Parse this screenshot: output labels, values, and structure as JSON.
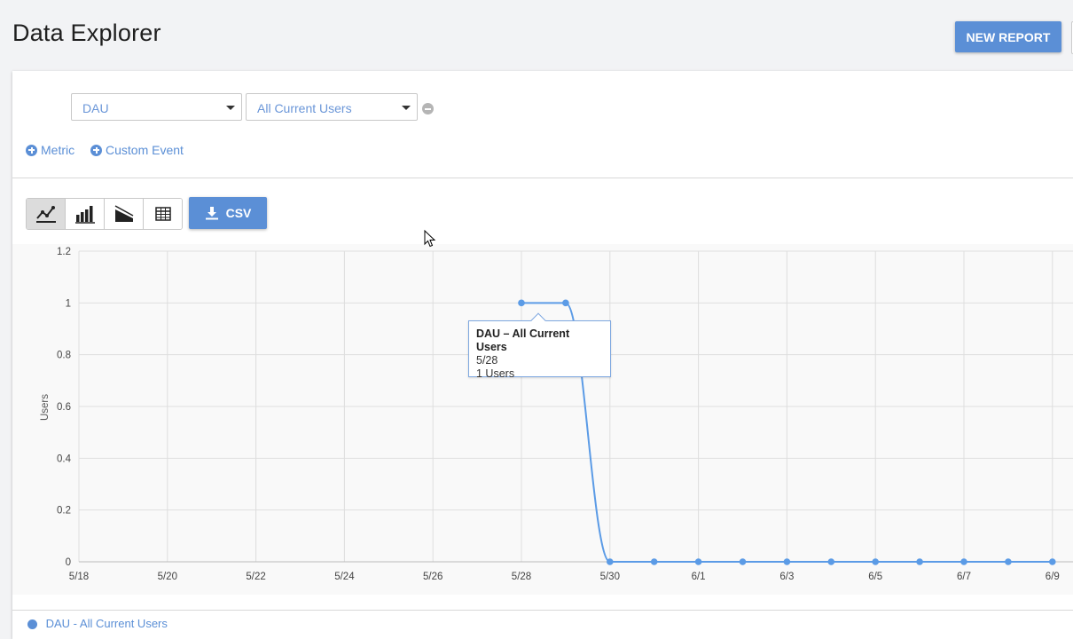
{
  "header": {
    "title": "Data Explorer",
    "new_report_label": "NEW REPORT"
  },
  "query": {
    "metric_select": "DAU",
    "segment_select": "All Current Users",
    "add_metric_label": "Metric",
    "add_custom_event_label": "Custom Event"
  },
  "toolbar": {
    "chart_types": [
      {
        "name": "line-chart",
        "active": true
      },
      {
        "name": "bar-chart",
        "active": false
      },
      {
        "name": "area-chart",
        "active": false
      },
      {
        "name": "table",
        "active": false
      }
    ],
    "csv_label": "CSV"
  },
  "tooltip": {
    "title": "DAU – All Current Users",
    "date": "5/28",
    "value": "1 Users"
  },
  "legend": {
    "label": "DAU - All Current Users"
  },
  "colors": {
    "accent": "#5b8fd6",
    "series": "#5b9be6"
  },
  "chart_data": {
    "type": "line",
    "ylabel": "Users",
    "ylim": [
      0,
      1.2
    ],
    "yticks": [
      "1.2",
      "1",
      "0.8",
      "0.6",
      "0.4",
      "0.2",
      "0"
    ],
    "xticks": [
      "5/18",
      "5/20",
      "5/22",
      "5/24",
      "5/26",
      "5/28",
      "5/30",
      "6/1",
      "6/3",
      "6/5",
      "6/7",
      "6/9"
    ],
    "grid": true,
    "series": [
      {
        "x": [
          "5/28",
          "5/29",
          "5/30",
          "5/31",
          "6/1",
          "6/2",
          "6/3",
          "6/4",
          "6/5",
          "6/6",
          "6/7",
          "6/8",
          "6/9"
        ],
        "values": [
          1,
          1,
          0,
          0,
          0,
          0,
          0,
          0,
          0,
          0,
          0,
          0,
          0
        ]
      }
    ]
  }
}
